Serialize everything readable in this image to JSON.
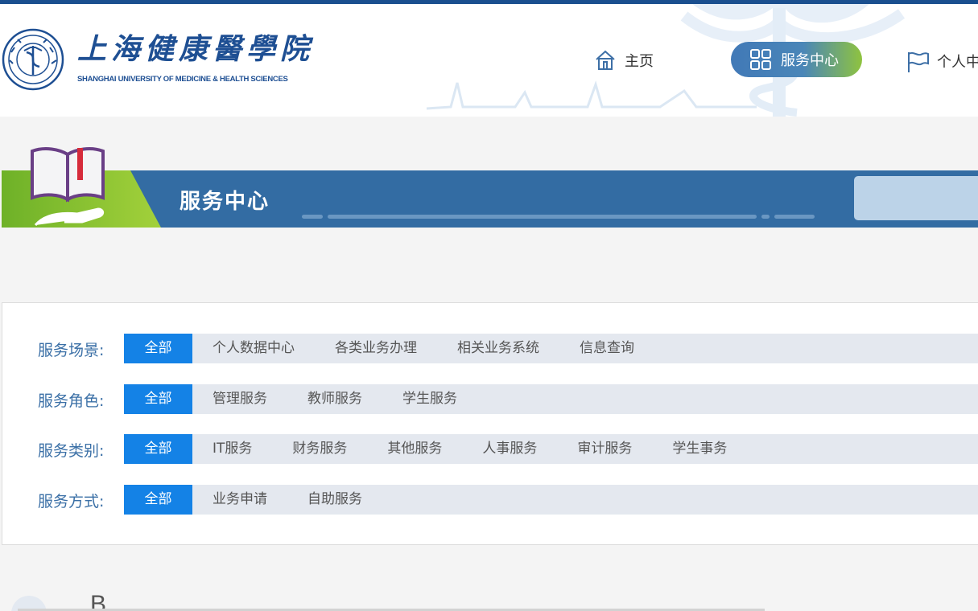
{
  "header": {
    "logo_cn": "上海健康醫學院",
    "logo_en": "SHANGHAI UNIVERSITY OF MEDICINE & HEALTH SCIENCES"
  },
  "nav": {
    "home": "主页",
    "service": "服务中心",
    "personal": "个人中"
  },
  "banner": {
    "title": "服务中心"
  },
  "filters": [
    {
      "label": "服务场景:",
      "options": [
        "全部",
        "个人数据中心",
        "各类业务办理",
        "相关业务系统",
        "信息查询"
      ],
      "active": 0
    },
    {
      "label": "服务角色:",
      "options": [
        "全部",
        "管理服务",
        "教师服务",
        "学生服务"
      ],
      "active": 0
    },
    {
      "label": "服务类别:",
      "options": [
        "全部",
        "IT服务",
        "财务服务",
        "其他服务",
        "人事服务",
        "审计服务",
        "学生事务"
      ],
      "active": 0
    },
    {
      "label": "服务方式:",
      "options": [
        "全部",
        "业务申请",
        "自助服务"
      ],
      "active": 0
    }
  ],
  "bottom": {
    "letter": "B"
  },
  "colors": {
    "topbar": "#1a4f8f",
    "banner": "#336ca3",
    "active_option": "#1482e6",
    "filter_label": "#3a6fa6"
  }
}
